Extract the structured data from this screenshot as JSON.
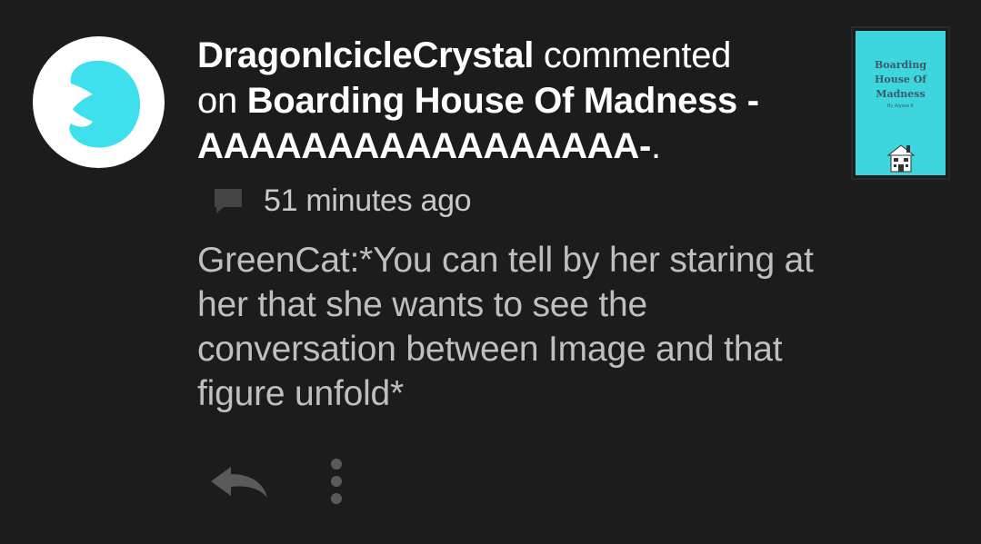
{
  "notification": {
    "username": "DragonIcicleCrystal",
    "action_text": " commented",
    "preposition": "on ",
    "story_title": "Boarding House Of Madness - AAAAAAAAAAAAAAAAA-",
    "trailing_period": ".",
    "timestamp": "51 minutes ago",
    "comment_text": "GreenCat:*You can tell by her staring at her that she wants to see the conversation between Image and that figure unfold*"
  },
  "cover": {
    "title": "Boarding House Of Madness",
    "author": "By Alyssa K",
    "background_color": "#3dd6df"
  },
  "avatar": {
    "icon": "cyan-blob-avatar",
    "color": "#3fe0ee"
  },
  "icons": {
    "comment": "speech-bubble-icon",
    "reply": "reply-arrow-icon",
    "more": "vertical-dots-icon"
  },
  "colors": {
    "background": "#1c1c1c",
    "headline": "#ffffff",
    "secondary_text": "#bfbfbf",
    "icon_gray": "#5a5a5a"
  }
}
